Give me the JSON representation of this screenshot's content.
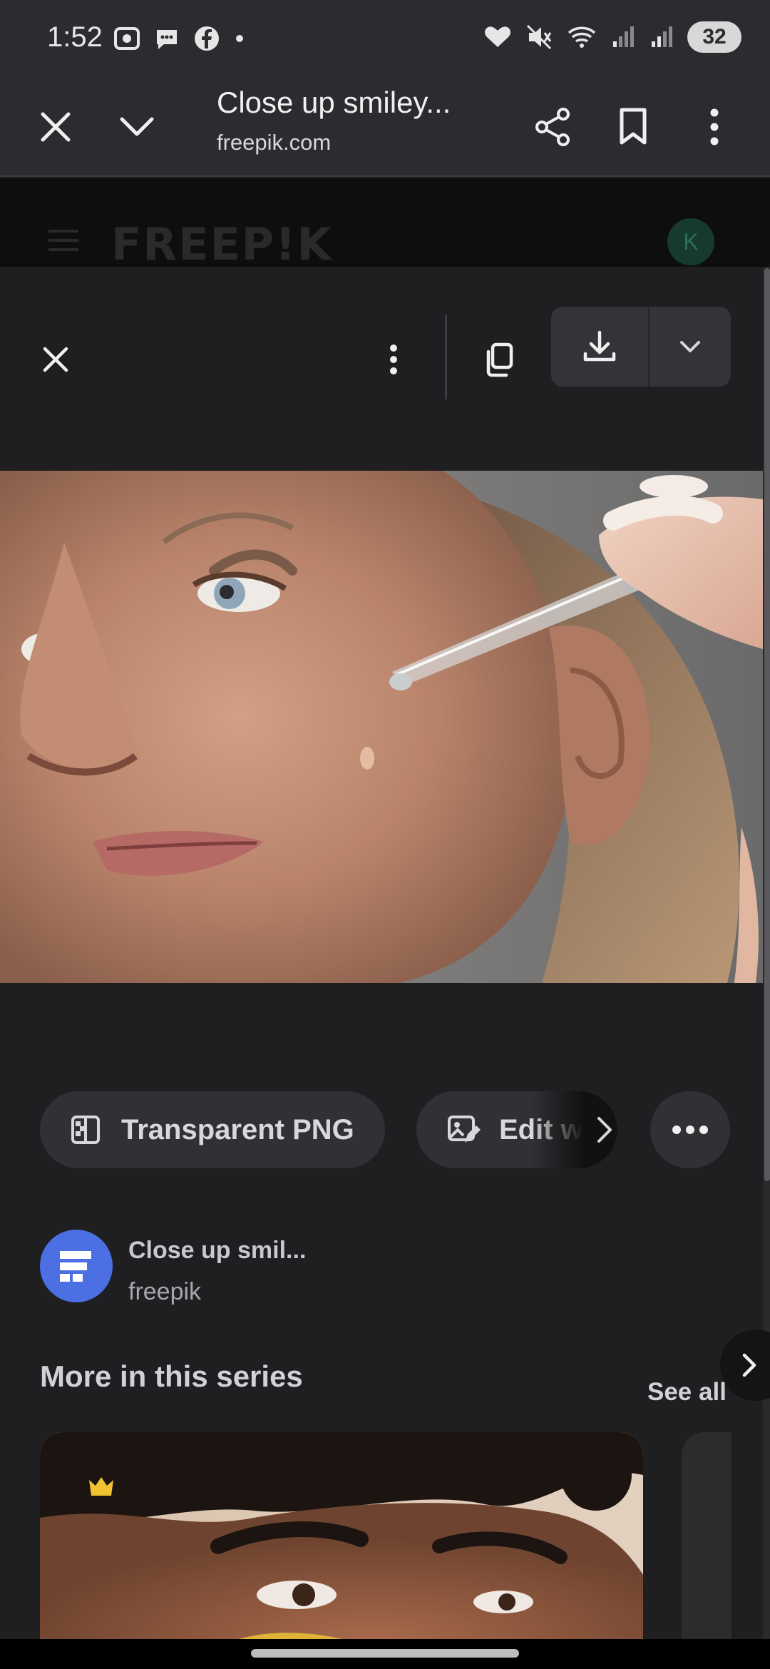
{
  "status_bar": {
    "time": "1:52",
    "battery": "32"
  },
  "toolbar": {
    "title": "Close up smiley...",
    "domain": "freepik.com"
  },
  "site": {
    "logo": "FREEP!K",
    "avatar_initial": "K"
  },
  "actions": {
    "transparent_png": "Transparent PNG",
    "edit": "Edit w"
  },
  "author": {
    "title": "Close up smil...",
    "name": "freepik"
  },
  "series": {
    "title": "More in this series",
    "see_all": "See all"
  },
  "icons": {
    "close": "close-icon",
    "collapse": "chevron-down-icon",
    "share": "share-icon",
    "bookmark": "bookmark-icon",
    "menu": "more-vertical-icon",
    "copy": "copy-icon",
    "download": "download-icon",
    "crown": "crown-icon"
  },
  "colors": {
    "background": "#1f1f21",
    "toolbar": "#2b2c30",
    "pill": "#313135",
    "author_avatar": "#4c6fe4",
    "crown": "#f2c230"
  }
}
